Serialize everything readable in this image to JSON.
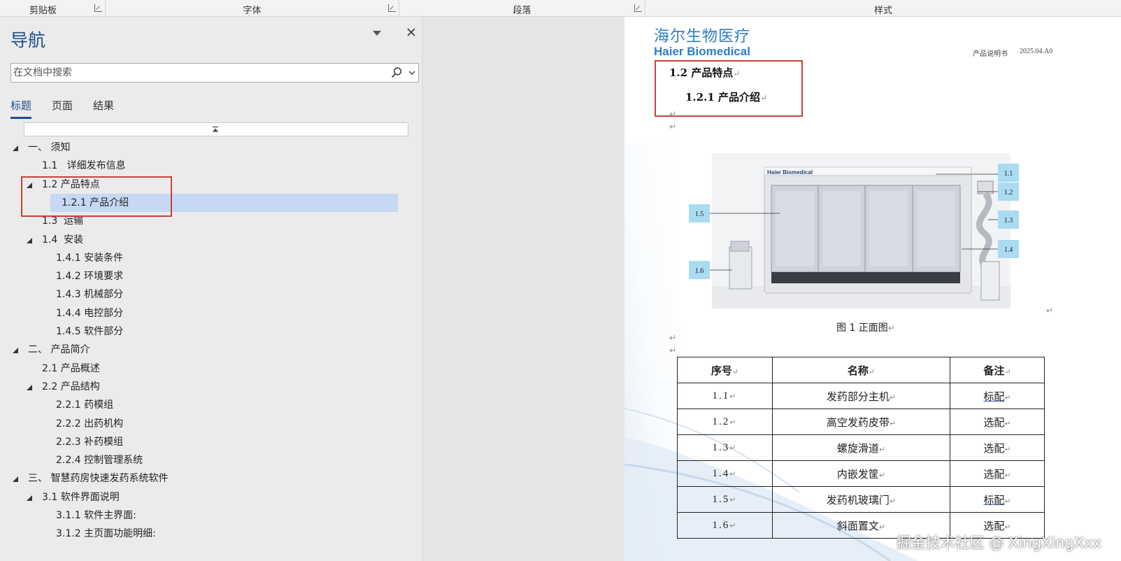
{
  "ribbon": {
    "groups": [
      "剪贴板",
      "字体",
      "段落",
      "样式"
    ]
  },
  "nav": {
    "title": "导航",
    "search_placeholder": "在文档中搜索",
    "tabs": [
      "标题",
      "页面",
      "结果"
    ],
    "active_tab": "标题",
    "tree": [
      {
        "label": "一、 须知",
        "level": 0,
        "expanded": true
      },
      {
        "label": "1.1   详细发布信息",
        "level": 1
      },
      {
        "label": "1.2 产品特点",
        "level": 1,
        "expanded": true
      },
      {
        "label": "1.2.1 产品介绍",
        "level": 2,
        "selected": true
      },
      {
        "label": "1.3  运输",
        "level": 1
      },
      {
        "label": "1.4  安装",
        "level": 1,
        "expanded": true
      },
      {
        "label": "1.4.1 安装条件",
        "level": 2
      },
      {
        "label": "1.4.2 环境要求",
        "level": 2
      },
      {
        "label": "1.4.3 机械部分",
        "level": 2
      },
      {
        "label": "1.4.4 电控部分",
        "level": 2
      },
      {
        "label": "1.4.5 软件部分",
        "level": 2
      },
      {
        "label": "二、 产品简介",
        "level": 0,
        "expanded": true
      },
      {
        "label": "2.1 产品概述",
        "level": 1
      },
      {
        "label": "2.2 产品结构",
        "level": 1,
        "expanded": true
      },
      {
        "label": "2.2.1 药模组",
        "level": 2
      },
      {
        "label": "2.2.2 出药机构",
        "level": 2
      },
      {
        "label": "2.2.3 补药模组",
        "level": 2
      },
      {
        "label": "2.2.4 控制管理系统",
        "level": 2
      },
      {
        "label": "三、 智慧药房快速发药系统软件",
        "level": 0,
        "expanded": true
      },
      {
        "label": "3.1 软件界面说明",
        "level": 1,
        "expanded": true
      },
      {
        "label": "3.1.1 软件主界面:",
        "level": 2
      },
      {
        "label": "3.1.2 主页面功能明细:",
        "level": 2
      }
    ]
  },
  "doc": {
    "logo_cn": "海尔生物医疗",
    "logo_en": "Haier Biomedical",
    "header_doctype": "产品说明书",
    "header_version": "2025.04.A0",
    "heading_12": "1.2 产品特点",
    "heading_121": "1.2.1 产品介绍",
    "figure": {
      "brand": "Haier Biomedical",
      "callouts": [
        "1.1",
        "1.2",
        "1.3",
        "1.4",
        "1.5",
        "1.6"
      ]
    },
    "figure_caption": "图 1 正面图",
    "table": {
      "headers": [
        "序号",
        "名称",
        "备注"
      ],
      "rows": [
        [
          "1.1",
          "发药部分主机",
          "标配"
        ],
        [
          "1.2",
          "高空发药皮带",
          "选配"
        ],
        [
          "1.3",
          "螺旋滑道",
          "选配"
        ],
        [
          "1.4",
          "内嵌发筐",
          "选配"
        ],
        [
          "1.5",
          "发药机玻璃门",
          "标配"
        ],
        [
          "1.6",
          "斜面置文",
          "选配"
        ]
      ]
    }
  },
  "watermark": "掘金技术社区 @ XingXingXxx",
  "colors": {
    "nav_title": "#1e4e8c",
    "selection": "#c6d8f3",
    "highlight_box": "#c8423a",
    "callout": "#a9dbf3",
    "logo": "#2d7ec6"
  }
}
